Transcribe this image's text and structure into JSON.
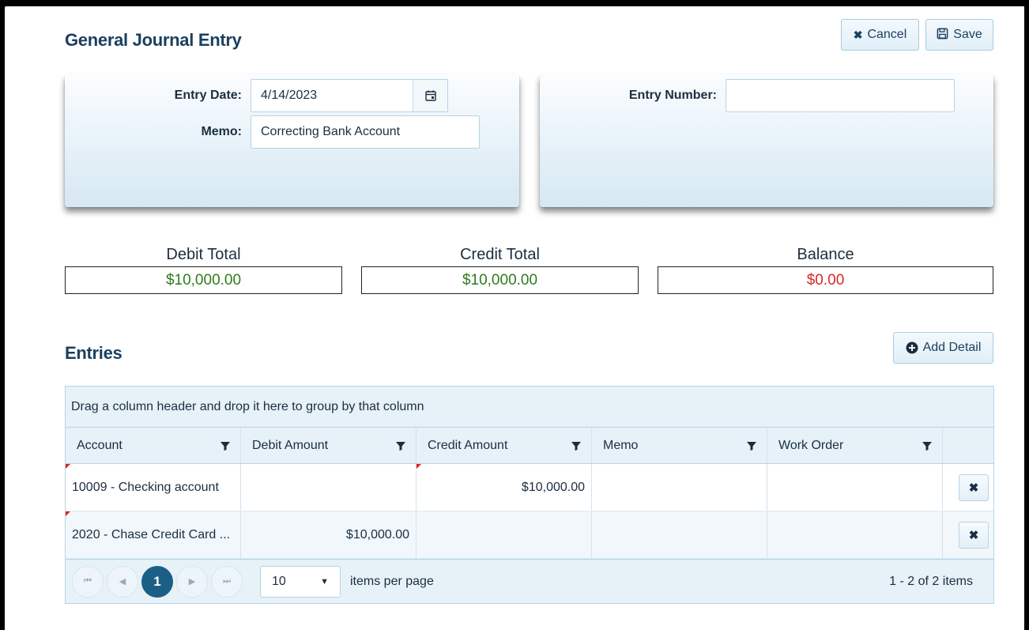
{
  "page": {
    "title": "General Journal Entry"
  },
  "toolbar": {
    "cancel_label": "Cancel",
    "save_label": "Save"
  },
  "form": {
    "entry_date_label": "Entry Date:",
    "entry_date_value": "4/14/2023",
    "memo_label": "Memo:",
    "memo_value": "Correcting Bank Account",
    "entry_number_label": "Entry Number:",
    "entry_number_value": ""
  },
  "totals": {
    "debit_label": "Debit Total",
    "debit_value": "$10,000.00",
    "credit_label": "Credit Total",
    "credit_value": "$10,000.00",
    "balance_label": "Balance",
    "balance_value": "$0.00"
  },
  "entries": {
    "title": "Entries",
    "add_detail_label": "Add Detail",
    "group_hint": "Drag a column header and drop it here to group by that column",
    "columns": [
      "Account",
      "Debit Amount",
      "Credit Amount",
      "Memo",
      "Work Order"
    ],
    "rows": [
      {
        "account": "10009 - Checking account",
        "debit": "",
        "credit": "$10,000.00",
        "memo": "",
        "work_order": ""
      },
      {
        "account": "2020 - Chase Credit Card ...",
        "debit": "$10,000.00",
        "credit": "",
        "memo": "",
        "work_order": ""
      }
    ]
  },
  "pager": {
    "current_page": "1",
    "page_size": "10",
    "items_per_page_label": "items per page",
    "info": "1 - 2 of 2 items"
  },
  "colors": {
    "accent": "#1c5f86",
    "title": "#1b3f5e",
    "debit_credit": "#2e7d1e",
    "balance": "#d62a2a"
  }
}
